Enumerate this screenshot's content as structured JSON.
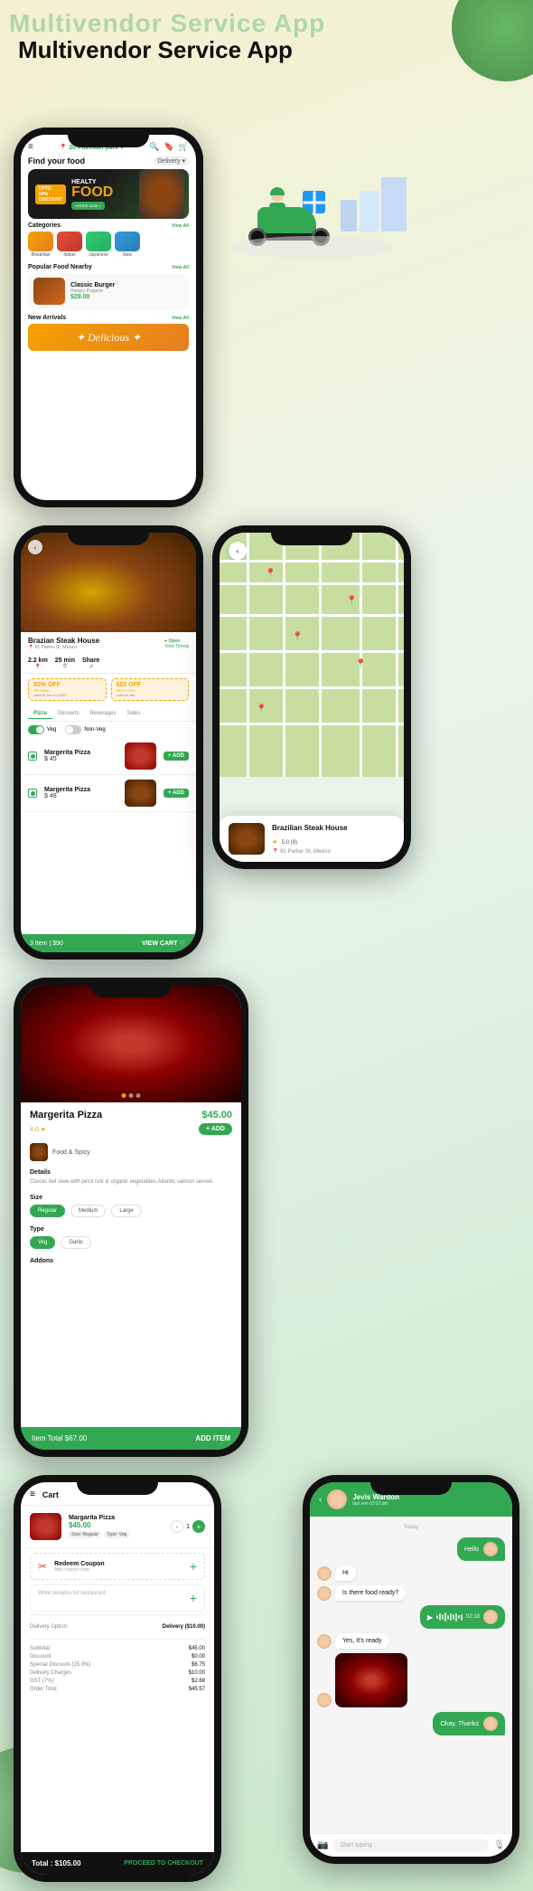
{
  "header": {
    "title_bg": "Multivendor Service App",
    "title": "Multivendor Service App"
  },
  "deco": {
    "circle_top": "top-right circle",
    "circle_bottom": "bottom-left circle"
  },
  "phone1": {
    "location": "📍 20 Pavelian park ▾",
    "find_food": "Find your food",
    "delivery": "Delivery ▾",
    "banner": {
      "discount": "UPTO\n60%\nDISCOUNT",
      "healty": "HEALTY",
      "food": "FOOD",
      "order": "ORDER NOW >"
    },
    "categories": {
      "title": "Categories",
      "view_all": "View All",
      "items": [
        {
          "label": "Breakfast",
          "type": "breakfast"
        },
        {
          "label": "Italian",
          "type": "italian"
        },
        {
          "label": "Japanese",
          "type": "japanese"
        },
        {
          "label": "New",
          "type": "new"
        }
      ]
    },
    "popular": {
      "title": "Popular Food Nearby",
      "view_all": "View All",
      "item": {
        "name": "Classic Burger",
        "vendor": "Hungry Puppets",
        "price": "$29.00"
      }
    },
    "new_arrivals": {
      "title": "New Arrivals",
      "view_all": "View All",
      "banner_text": "Delicious"
    }
  },
  "phone_map": {
    "restaurant": {
      "name": "Brazilian Steak House",
      "rating": "5.0",
      "reviews": "8",
      "address": "91 Parker St, Mexico"
    }
  },
  "phone2": {
    "restaurant_name": "Brazian Steak House",
    "open_status": "● Open",
    "address": "91 Parker St. Mexico",
    "view_timing": "View Timing",
    "distance": "2.2 km",
    "time": "25 min",
    "share": "Share",
    "coupons": [
      {
        "discount": "50% OFF",
        "code": "TRYNEW",
        "valid": "valid till Jan 31,2022"
      },
      {
        "discount": "$20 OFF",
        "code": "FIRSTYOU",
        "valid": "valid till Jan..."
      }
    ],
    "tabs": [
      "Pizza",
      "Desserts",
      "Beverages",
      "Sides"
    ],
    "active_tab": "Pizza",
    "veg": "Veg",
    "non_veg": "Non-Veg",
    "items": [
      {
        "name": "Margerita Pizza",
        "price": "$ 45",
        "add": "+ ADD"
      },
      {
        "name": "Margerita Pizza",
        "price": "$ 48",
        "add": "+ ADD"
      }
    ],
    "cart_count": "3 Item | $90",
    "view_cart": "VIEW CART 🛒"
  },
  "phone_pizza": {
    "name": "Margerita Pizza",
    "price": "$45.00",
    "rating": "4.0 ★",
    "add_btn": "+ ADD",
    "restaurant": "Food & Spicy",
    "details_title": "Details",
    "description": "Classic bef stew with pinot noir & organic vegetables.Atlantic salmon served.",
    "size_title": "Size",
    "sizes": [
      "Regular",
      "Medium",
      "Large"
    ],
    "active_size": "Regular",
    "type_title": "Type",
    "types": [
      "Veg",
      "Garlic"
    ],
    "active_type": "Veg",
    "addons_title": "Addons",
    "item_total": "Item Total $67.00",
    "add_item_btn": "ADD ITEM"
  },
  "phone_cart": {
    "title": "Cart",
    "item": {
      "name": "Margarita Pizza",
      "price": "$45.00",
      "qty": "1",
      "tags": [
        "Size: Regular",
        "Type: Veg"
      ]
    },
    "redeem": {
      "title": "Redeem Coupon",
      "subtitle": "Add coupon code"
    },
    "remarks_placeholder": "Write remarks for restaurant",
    "delivery_option_label": "Delivery Option:",
    "delivery_option_value": "Delivery ($10.00)",
    "prices": [
      {
        "label": "Subtotal",
        "value": "$45.00"
      },
      {
        "label": "Discount",
        "value": "$0.00"
      },
      {
        "label": "Special Discount (15.0%)",
        "value": "$6.75"
      },
      {
        "label": "Delivery Charges",
        "value": "$10.00"
      },
      {
        "label": "GST (7%)",
        "value": "$2.68"
      },
      {
        "label": "Order Total",
        "value": "$45.57"
      }
    ],
    "total": "Total : $105.00",
    "checkout_btn": "PROCEED TO CHECKOUT"
  },
  "phone_chat": {
    "user_name": "Jevis Wardon",
    "status": "last sen 03:22 pm",
    "date_label": "Today",
    "messages": [
      {
        "type": "right",
        "text": "Hello"
      },
      {
        "type": "left",
        "text": "Hi"
      },
      {
        "type": "left",
        "text": "Is there food ready?"
      },
      {
        "type": "right_audio",
        "time": "02:18"
      },
      {
        "type": "left",
        "text": "Yes, It's ready"
      },
      {
        "type": "left_image",
        "alt": "pizza image"
      },
      {
        "type": "right",
        "text": "Okay, Thanks"
      }
    ],
    "input_placeholder": "Start typing ,"
  }
}
